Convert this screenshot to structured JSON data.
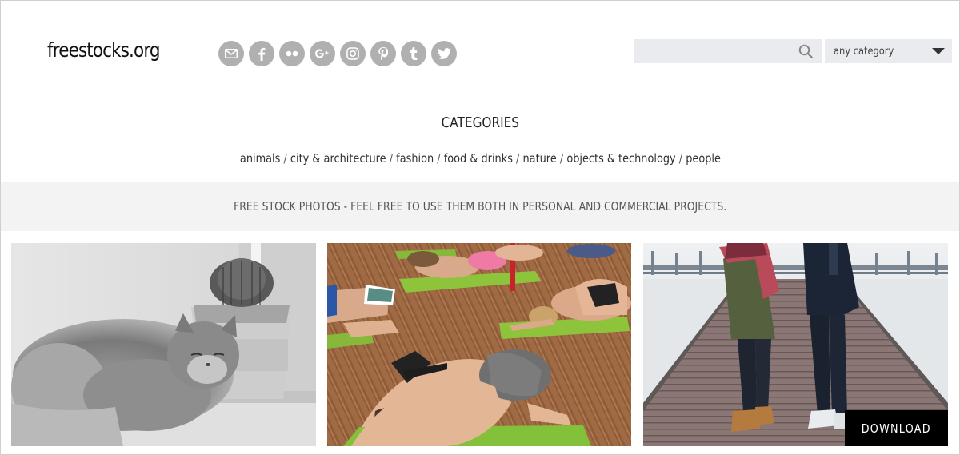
{
  "header": {
    "logo": "freestocks.org",
    "social_icons": [
      "mail-icon",
      "facebook-icon",
      "flickr-icon",
      "google-plus-icon",
      "instagram-icon",
      "pinterest-icon",
      "tumblr-icon",
      "twitter-icon"
    ],
    "search": {
      "placeholder": "",
      "icon": "search-icon"
    },
    "category_select": {
      "selected": "any category",
      "icon": "caret-down-icon"
    }
  },
  "categories": {
    "heading": "CATEGORIES",
    "links": [
      "animals",
      "city & architecture",
      "fashion",
      "food & drinks",
      "nature",
      "objects & technology",
      "people"
    ],
    "separator": " / "
  },
  "banner": {
    "text": "FREE STOCK PHOTOS - FEEL FREE TO USE THEM BOTH IN PERSONAL AND COMMERCIAL PROJECTS."
  },
  "gallery": {
    "photos": [
      "cat-beside-cactus-photo",
      "yoga-class-photo",
      "couple-on-pier-photo"
    ],
    "download_label": "DOWNLOAD"
  },
  "colors": {
    "social_bg": "#b0b0b0",
    "input_bg": "#e9ebee",
    "banner_bg": "#f3f3f3",
    "download_bg": "#000000"
  }
}
